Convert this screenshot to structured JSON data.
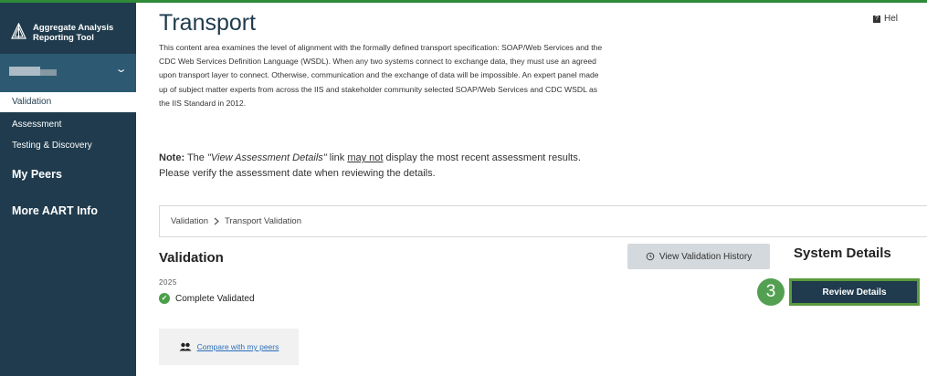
{
  "sidebar": {
    "brand": {
      "line1": "Aggregate Analysis",
      "line2": "Reporting Tool"
    },
    "items": [
      {
        "label": "Validation"
      },
      {
        "label": "Assessment"
      },
      {
        "label": "Testing & Discovery"
      }
    ],
    "main_items": [
      {
        "label": "My Peers"
      },
      {
        "label": "More AART Info"
      }
    ]
  },
  "header": {
    "title": "Transport",
    "help_label": "Hel"
  },
  "description": "This content area examines the level of alignment with the formally defined transport specification: SOAP/Web Services and the CDC Web Services Definition Language (WSDL). When any two systems connect to exchange data, they must use an agreed upon transport layer to connect. Otherwise, communication and the exchange of data will be impossible. An expert panel made up of subject matter experts from across the IIS and stakeholder community selected SOAP/Web Services and CDC WSDL as the IIS Standard in 2012.",
  "note": {
    "label": "Note:",
    "part1": " The ",
    "emph": "\"View Assessment Details\"",
    "part2": " link ",
    "underline": "may not",
    "part3": " display the most recent assessment results. Please verify the assessment date when reviewing the details."
  },
  "breadcrumb": {
    "items": [
      "Validation",
      "Transport Validation"
    ]
  },
  "validation": {
    "title": "Validation",
    "year": "2025",
    "status": "Complete Validated",
    "history_button": "View Validation History"
  },
  "system_details": {
    "title": "System Details",
    "step_number": "3",
    "review_button": "Review Details"
  },
  "compare": {
    "label": "Compare with my peers"
  },
  "colors": {
    "sidebar_bg": "#1f3b4d",
    "sidebar_user_bg": "#2d5a72",
    "accent_green": "#54a052",
    "link_blue": "#2a6ebb"
  }
}
